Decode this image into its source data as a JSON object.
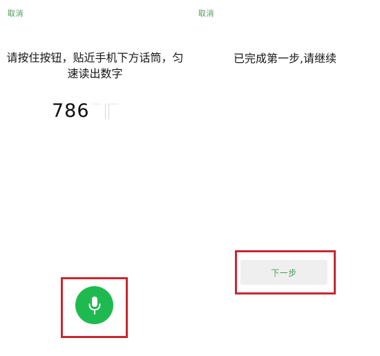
{
  "screen_left": {
    "cancel_label": "取消",
    "instruction_line1": "请按住按钮，贴近手机下方话筒，匀",
    "instruction_line2": "速读出数字",
    "digits_shown": "786",
    "mic_icon": "microphone-icon",
    "accent_color": "#1fba4f",
    "highlight_color": "#c8262f"
  },
  "screen_right": {
    "cancel_label": "取消",
    "status_message": "已完成第一步,请继续",
    "next_button_label": "下一步",
    "link_color": "#4b9a55"
  }
}
